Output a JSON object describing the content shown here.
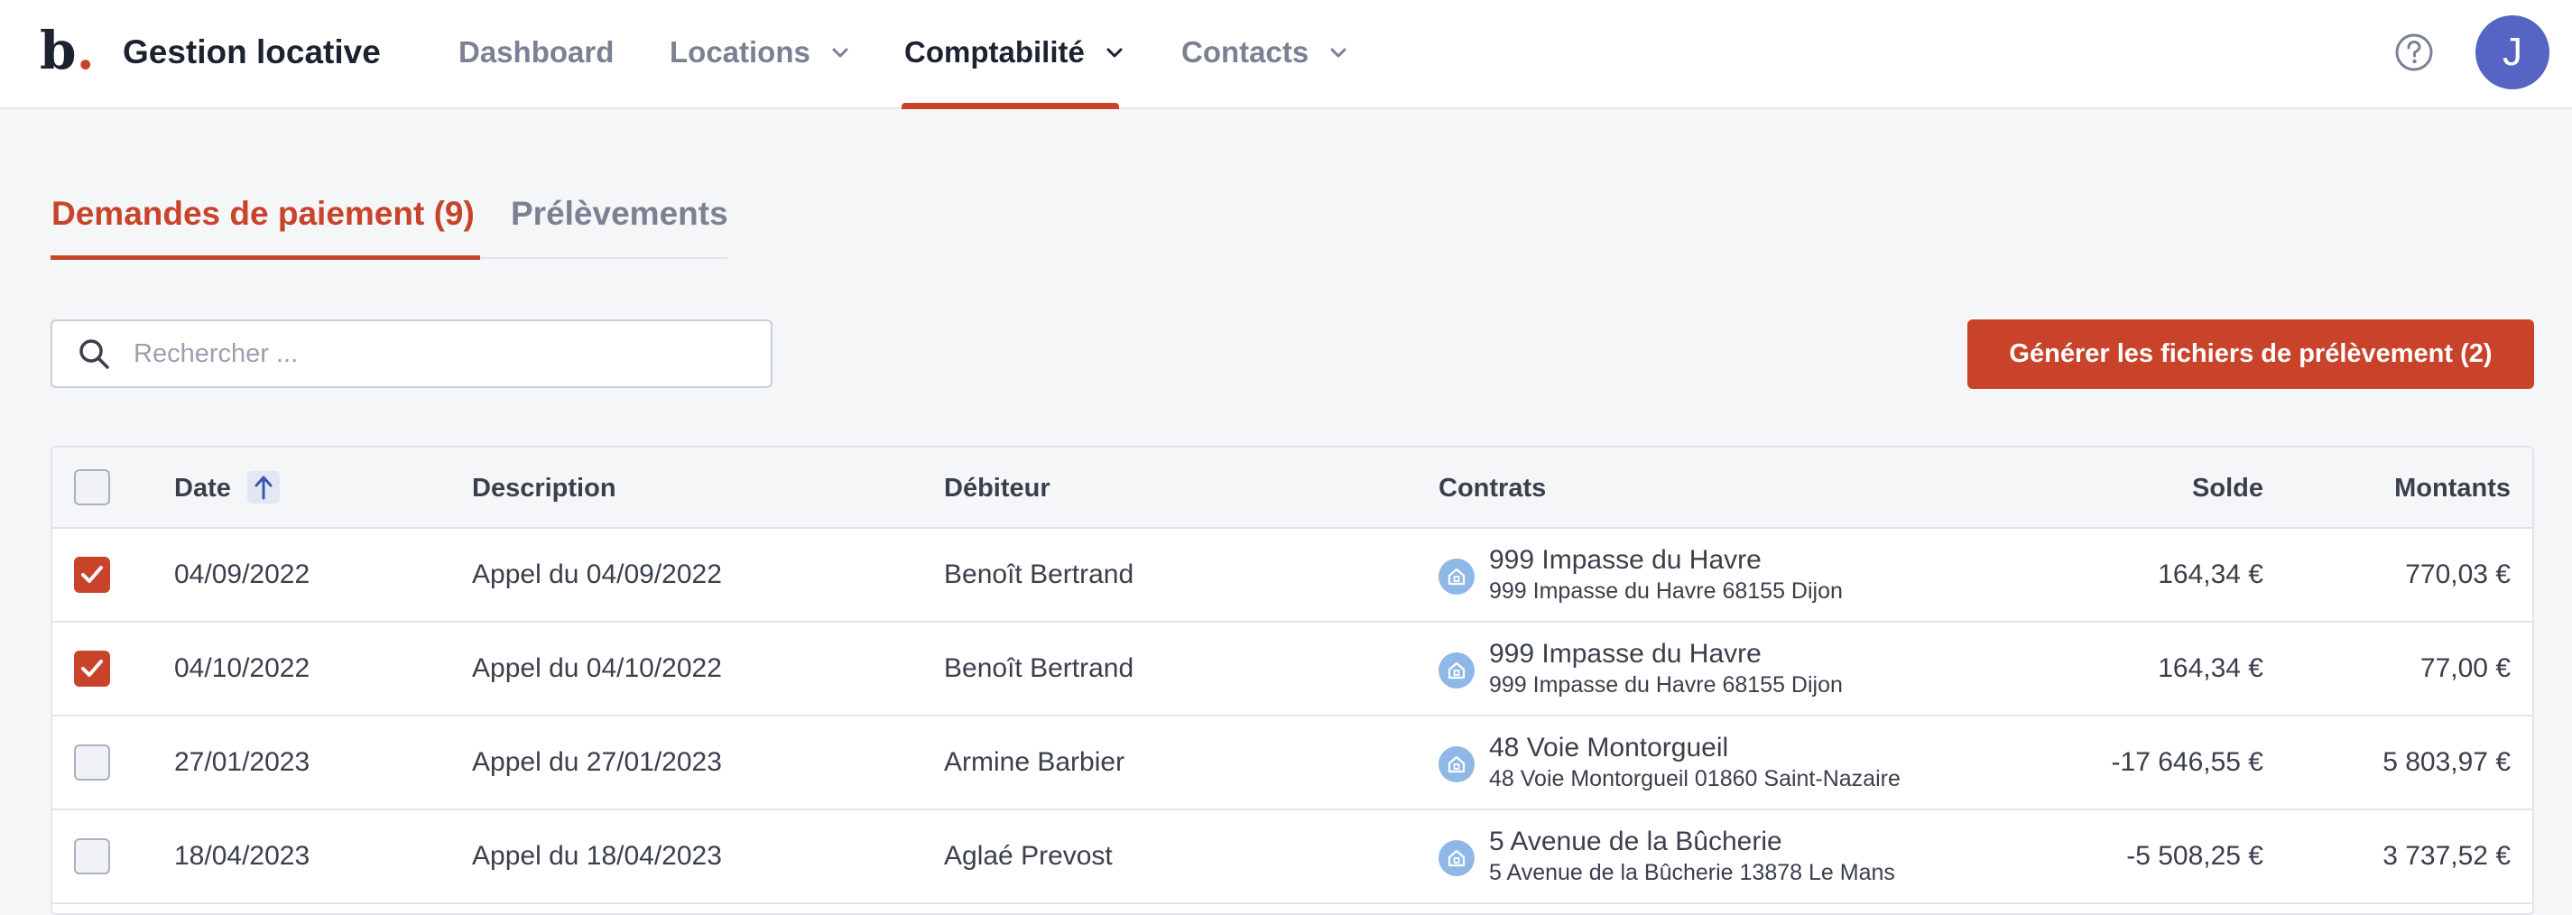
{
  "app": {
    "logo": "b",
    "logo_dot": ".",
    "title": "Gestion locative",
    "user_initial": "J"
  },
  "nav": {
    "items": [
      {
        "label": "Dashboard",
        "dropdown": false,
        "active": false
      },
      {
        "label": "Locations",
        "dropdown": true,
        "active": false
      },
      {
        "label": "Comptabilité",
        "dropdown": true,
        "active": true
      },
      {
        "label": "Contacts",
        "dropdown": true,
        "active": false
      }
    ]
  },
  "tabs": [
    {
      "label": "Demandes de paiement (9)",
      "active": true
    },
    {
      "label": "Prélèvements",
      "active": false
    }
  ],
  "search": {
    "placeholder": "Rechercher ...",
    "value": ""
  },
  "generate_button": {
    "label": "Générer les fichiers de prélèvement (2)"
  },
  "table": {
    "headers": {
      "date": "Date",
      "description": "Description",
      "debtor": "Débiteur",
      "contracts": "Contrats",
      "balance": "Solde",
      "amounts": "Montants"
    },
    "rows": [
      {
        "checked": true,
        "date": "04/09/2022",
        "description": "Appel du 04/09/2022",
        "debtor": "Benoît Bertrand",
        "contract_title": "999 Impasse du Havre",
        "contract_address": "999 Impasse du Havre 68155 Dijon",
        "balance": "164,34 €",
        "amount": "770,03 €"
      },
      {
        "checked": true,
        "date": "04/10/2022",
        "description": "Appel du 04/10/2022",
        "debtor": "Benoît Bertrand",
        "contract_title": "999 Impasse du Havre",
        "contract_address": "999 Impasse du Havre 68155 Dijon",
        "balance": "164,34 €",
        "amount": "77,00 €"
      },
      {
        "checked": false,
        "date": "27/01/2023",
        "description": "Appel du 27/01/2023",
        "debtor": "Armine Barbier",
        "contract_title": "48 Voie Montorgueil",
        "contract_address": "48 Voie Montorgueil 01860 Saint-Nazaire",
        "balance": "-17 646,55 €",
        "amount": "5 803,97 €"
      },
      {
        "checked": false,
        "date": "18/04/2023",
        "description": "Appel du 18/04/2023",
        "debtor": "Aglaé Prevost",
        "contract_title": "5 Avenue de la Bûcherie",
        "contract_address": "5 Avenue de la Bûcherie 13878 Le Mans",
        "balance": "-5 508,25 €",
        "amount": "3 737,52 €"
      }
    ]
  },
  "colors": {
    "accent": "#c9432a",
    "avatar": "#5664c4",
    "contract_icon": "#8fb8e6"
  },
  "icons": {
    "help": "question-circle-icon",
    "search": "magnifier-icon",
    "sort": "arrow-up-icon",
    "contract": "house-icon",
    "chevron": "chevron-down-icon"
  }
}
